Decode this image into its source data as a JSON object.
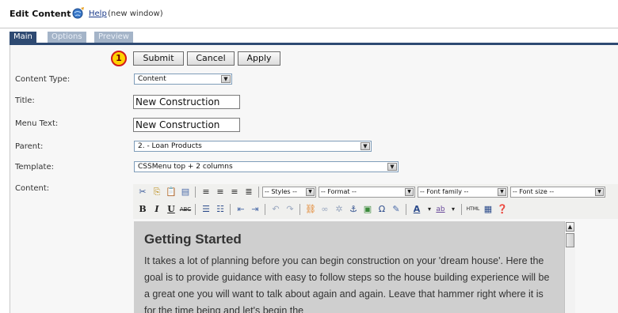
{
  "header": {
    "title": "Edit Content",
    "help_label": "Help",
    "help_note": "(new window)"
  },
  "tabs": [
    {
      "label": "Main",
      "active": true
    },
    {
      "label": "Options",
      "active": false
    },
    {
      "label": "Preview",
      "active": false
    }
  ],
  "callout_number": "1",
  "buttons": {
    "submit": "Submit",
    "cancel": "Cancel",
    "apply": "Apply"
  },
  "form": {
    "content_type_label": "Content Type:",
    "content_type_value": "Content",
    "title_label": "Title:",
    "title_value": "New Construction",
    "menu_text_label": "Menu Text:",
    "menu_text_value": "New Construction",
    "parent_label": "Parent:",
    "parent_value": "2. - Loan Products",
    "template_label": "Template:",
    "template_value": "CSSMenu top + 2 columns",
    "content_label": "Content:"
  },
  "toolbar": {
    "styles": "-- Styles --",
    "format": "-- Format --",
    "font_family": "-- Font family --",
    "font_size": "-- Font size --",
    "icons_row1": [
      "cut-icon",
      "copy-icon",
      "paste-icon",
      "paste-text-icon",
      "align-left-icon",
      "align-center-icon",
      "align-right-icon",
      "align-justify-icon"
    ],
    "icons_row2": [
      "bold-icon",
      "italic-icon",
      "underline-icon",
      "strikethrough-icon",
      "bullet-list-icon",
      "numbered-list-icon",
      "outdent-icon",
      "indent-icon",
      "undo-icon",
      "redo-icon",
      "link-icon",
      "unlink-icon",
      "unlink2-icon",
      "anchor-icon",
      "image-icon",
      "special-char-icon",
      "cleanup-icon",
      "text-color-icon",
      "highlight-color-icon",
      "html-icon",
      "fullscreen-icon",
      "help-icon"
    ]
  },
  "editor": {
    "heading": "Getting Started",
    "body": "It takes a lot of planning before you can begin construction on your 'dream house'. Here the goal is to provide guidance with easy to follow steps so the house building experience will be a great one you will want to talk about again and again. Leave that hammer right where it is for the time being and let's begin the"
  }
}
